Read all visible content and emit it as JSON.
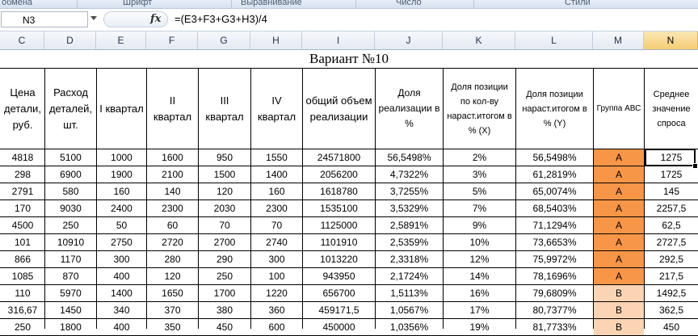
{
  "ribbon": {
    "groups": [
      "обмена",
      "Шрифт",
      "Выравнивание",
      "Число",
      "Стили"
    ]
  },
  "formula_bar": {
    "cell_ref": "N3",
    "fx_label": "fx",
    "formula": "=(E3+F3+G3+H3)/4"
  },
  "columns": [
    "C",
    "D",
    "E",
    "F",
    "G",
    "H",
    "I",
    "J",
    "K",
    "L",
    "M",
    "N"
  ],
  "selected_column": "N",
  "sheet": {
    "title": "Вариант №10",
    "headers": [
      "Цена детали, руб.",
      "Расход деталей, шт.",
      "I квартал",
      "II квартал",
      "III квартал",
      "IV квартал",
      "общий объем реализации",
      "Доля реализации в %",
      "Доля позиции по кол-ву нараст.итогом в % (X)",
      "Доля позиции нараст.итогом в % (Y)",
      "Группа АВС",
      "Среднее значение спроса"
    ],
    "rows": [
      [
        "4818",
        "5100",
        "1000",
        "1600",
        "950",
        "1550",
        "24571800",
        "56,5498%",
        "2%",
        "56,5498%",
        "A",
        "1275"
      ],
      [
        "298",
        "6900",
        "1900",
        "2100",
        "1500",
        "1400",
        "2056200",
        "4,7322%",
        "3%",
        "61,2819%",
        "A",
        "1725"
      ],
      [
        "2791",
        "580",
        "160",
        "140",
        "120",
        "160",
        "1618780",
        "3,7255%",
        "5%",
        "65,0074%",
        "A",
        "145"
      ],
      [
        "170",
        "9030",
        "2400",
        "2300",
        "2030",
        "2300",
        "1535100",
        "3,5329%",
        "7%",
        "68,5403%",
        "A",
        "2257,5"
      ],
      [
        "4500",
        "250",
        "50",
        "60",
        "70",
        "70",
        "1125000",
        "2,5891%",
        "9%",
        "71,1294%",
        "A",
        "62,5"
      ],
      [
        "101",
        "10910",
        "2750",
        "2720",
        "2700",
        "2740",
        "1101910",
        "2,5359%",
        "10%",
        "73,6653%",
        "A",
        "2727,5"
      ],
      [
        "866",
        "1170",
        "300",
        "280",
        "290",
        "300",
        "1013220",
        "2,3318%",
        "12%",
        "75,9972%",
        "A",
        "292,5"
      ],
      [
        "1085",
        "870",
        "400",
        "120",
        "250",
        "100",
        "943950",
        "2,1724%",
        "14%",
        "78,1696%",
        "A",
        "217,5"
      ],
      [
        "110",
        "5970",
        "1400",
        "1650",
        "1700",
        "1220",
        "656700",
        "1,5113%",
        "16%",
        "79,6809%",
        "B",
        "1492,5"
      ],
      [
        "316,67",
        "1450",
        "340",
        "370",
        "380",
        "360",
        "459171,5",
        "1,0567%",
        "17%",
        "80,7377%",
        "B",
        "362,5"
      ],
      [
        "250",
        "1800",
        "400",
        "350",
        "450",
        "600",
        "450000",
        "1,0356%",
        "19%",
        "81,7733%",
        "B",
        "450"
      ]
    ]
  },
  "colors": {
    "group_a": "#f79646",
    "group_b": "#fbd4b4",
    "selected_header": "#f6cd73"
  }
}
